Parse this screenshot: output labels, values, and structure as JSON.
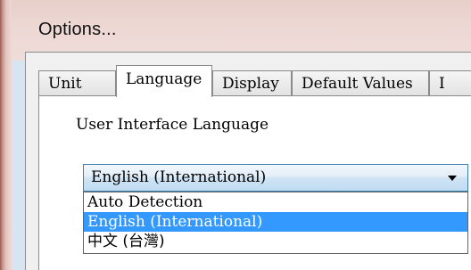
{
  "window": {
    "title": "Options..."
  },
  "tabs": [
    {
      "label": "Unit",
      "selected": false
    },
    {
      "label": "Language",
      "selected": true
    },
    {
      "label": "Display",
      "selected": false
    },
    {
      "label": "Default Values",
      "selected": false
    },
    {
      "label": "I",
      "selected": false
    }
  ],
  "language_panel": {
    "section_label": "User Interface Language",
    "combo": {
      "selected_value": "English (International)",
      "expanded": true
    },
    "options": [
      {
        "label": "Auto Detection",
        "highlighted": false
      },
      {
        "label": "English (International)",
        "highlighted": true
      },
      {
        "label": "中文 (台灣)",
        "highlighted": false
      }
    ]
  },
  "colors": {
    "highlight": "#3399ff",
    "titlebar": "#ecd7d3",
    "combo_border": "#3c7fb1"
  }
}
